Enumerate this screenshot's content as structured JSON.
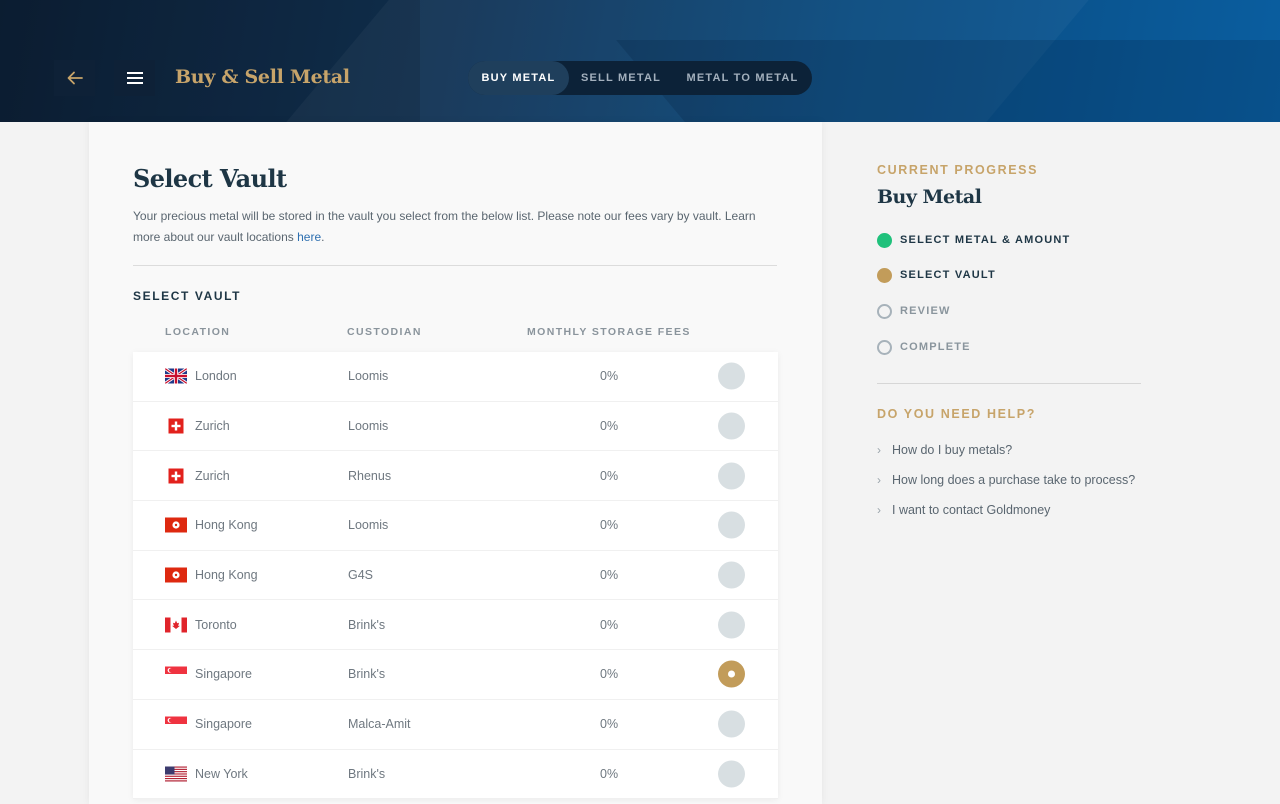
{
  "header": {
    "app_title": "Buy & Sell Metal",
    "back_icon": "arrow-left-icon",
    "menu_icon": "hamburger-menu-icon",
    "tabs": [
      {
        "label": "BUY METAL",
        "active": true
      },
      {
        "label": "SELL METAL",
        "active": false
      },
      {
        "label": "METAL TO METAL",
        "active": false
      }
    ]
  },
  "main": {
    "title": "Select Vault",
    "intro_text": "Your precious metal will be stored in the vault you select from the below list. Please note our fees vary by vault. Learn more about our vault locations ",
    "intro_link": "here",
    "intro_end": ".",
    "section_label": "SELECT VAULT",
    "columns": [
      "LOCATION",
      "CUSTODIAN",
      "MONTHLY STORAGE FEES"
    ],
    "vaults": [
      {
        "flag": "uk-flag-icon",
        "location": "London",
        "custodian": "Loomis",
        "fee": "0%",
        "selected": false
      },
      {
        "flag": "switzerland-flag-icon",
        "location": "Zurich",
        "custodian": "Loomis",
        "fee": "0%",
        "selected": false
      },
      {
        "flag": "switzerland-flag-icon",
        "location": "Zurich",
        "custodian": "Rhenus",
        "fee": "0%",
        "selected": false
      },
      {
        "flag": "hong-kong-flag-icon",
        "location": "Hong Kong",
        "custodian": "Loomis",
        "fee": "0%",
        "selected": false
      },
      {
        "flag": "hong-kong-flag-icon",
        "location": "Hong Kong",
        "custodian": "G4S",
        "fee": "0%",
        "selected": false
      },
      {
        "flag": "canada-flag-icon",
        "location": "Toronto",
        "custodian": "Brink's",
        "fee": "0%",
        "selected": false
      },
      {
        "flag": "singapore-flag-icon",
        "location": "Singapore",
        "custodian": "Brink's",
        "fee": "0%",
        "selected": true
      },
      {
        "flag": "singapore-flag-icon",
        "location": "Singapore",
        "custodian": "Malca-Amit",
        "fee": "0%",
        "selected": false
      },
      {
        "flag": "usa-flag-icon",
        "location": "New York",
        "custodian": "Brink's",
        "fee": "0%",
        "selected": false
      }
    ]
  },
  "sidebar": {
    "progress_label": "CURRENT PROGRESS",
    "progress_title": "Buy Metal",
    "steps": [
      {
        "label": "SELECT METAL & AMOUNT",
        "status": "done"
      },
      {
        "label": "SELECT VAULT",
        "status": "current"
      },
      {
        "label": "REVIEW",
        "status": "todo"
      },
      {
        "label": "COMPLETE",
        "status": "todo"
      }
    ],
    "help_label": "DO YOU NEED HELP?",
    "help_links": [
      "How do I buy metals?",
      "How long does a purchase take to process?",
      "I want to contact Goldmoney"
    ]
  },
  "colors": {
    "gold": "#c7a46a",
    "navy": "#1e3645",
    "done_green": "#1fc17b",
    "selected_radio": "#c29c5a"
  }
}
